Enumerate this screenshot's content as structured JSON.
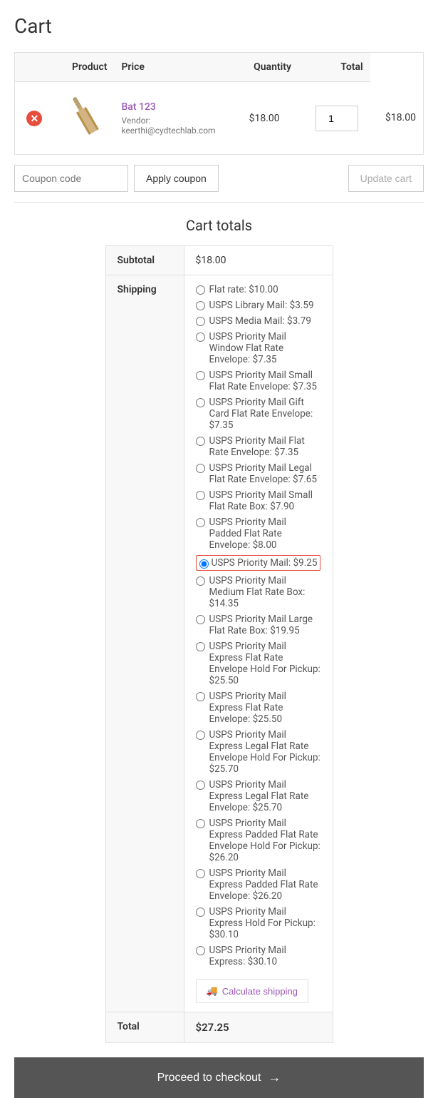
{
  "page": {
    "title": "Cart"
  },
  "table": {
    "headers": {
      "product": "Product",
      "price": "Price",
      "quantity": "Quantity",
      "total": "Total"
    }
  },
  "cart_item": {
    "product_name": "Bat 123",
    "product_link": "#",
    "vendor_label": "Vendor:",
    "vendor_email": "keerthi@cydtechlab.com",
    "price": "$18.00",
    "quantity": 1,
    "total": "$18.00"
  },
  "coupon": {
    "placeholder": "Coupon code",
    "apply_label": "Apply coupon",
    "update_label": "Update cart"
  },
  "cart_totals": {
    "title": "Cart totals",
    "subtotal_label": "Subtotal",
    "subtotal_value": "$18.00",
    "shipping_label": "Shipping",
    "total_label": "Total",
    "total_value": "$27.25"
  },
  "shipping_options": [
    {
      "id": "flat_rate",
      "label": "Flat rate: $10.00",
      "selected": false
    },
    {
      "id": "usps_library",
      "label": "USPS Library Mail: $3.59",
      "selected": false
    },
    {
      "id": "usps_media",
      "label": "USPS Media Mail: $3.79",
      "selected": false
    },
    {
      "id": "usps_priority_window",
      "label": "USPS Priority Mail Window Flat Rate Envelope: $7.35",
      "selected": false
    },
    {
      "id": "usps_priority_small_env",
      "label": "USPS Priority Mail Small Flat Rate Envelope: $7.35",
      "selected": false
    },
    {
      "id": "usps_priority_gift",
      "label": "USPS Priority Mail Gift Card Flat Rate Envelope: $7.35",
      "selected": false
    },
    {
      "id": "usps_priority_flat",
      "label": "USPS Priority Mail Flat Rate Envelope: $7.35",
      "selected": false
    },
    {
      "id": "usps_priority_legal",
      "label": "USPS Priority Mail Legal Flat Rate Envelope: $7.65",
      "selected": false
    },
    {
      "id": "usps_priority_small_box",
      "label": "USPS Priority Mail Small Flat Rate Box: $7.90",
      "selected": false
    },
    {
      "id": "usps_priority_padded",
      "label": "USPS Priority Mail Padded Flat Rate Envelope: $8.00",
      "selected": false
    },
    {
      "id": "usps_priority",
      "label": "USPS Priority Mail: $9.25",
      "selected": true
    },
    {
      "id": "usps_priority_medium",
      "label": "USPS Priority Mail Medium Flat Rate Box: $14.35",
      "selected": false
    },
    {
      "id": "usps_priority_large",
      "label": "USPS Priority Mail Large Flat Rate Box: $19.95",
      "selected": false
    },
    {
      "id": "usps_express_env_pickup",
      "label": "USPS Priority Mail Express Flat Rate Envelope Hold For Pickup: $25.50",
      "selected": false
    },
    {
      "id": "usps_express_env",
      "label": "USPS Priority Mail Express Flat Rate Envelope: $25.50",
      "selected": false
    },
    {
      "id": "usps_express_legal_pickup",
      "label": "USPS Priority Mail Express Legal Flat Rate Envelope Hold For Pickup: $25.70",
      "selected": false
    },
    {
      "id": "usps_express_legal",
      "label": "USPS Priority Mail Express Legal Flat Rate Envelope: $25.70",
      "selected": false
    },
    {
      "id": "usps_express_padded_pickup",
      "label": "USPS Priority Mail Express Padded Flat Rate Envelope Hold For Pickup: $26.20",
      "selected": false
    },
    {
      "id": "usps_express_padded",
      "label": "USPS Priority Mail Express Padded Flat Rate Envelope: $26.20",
      "selected": false
    },
    {
      "id": "usps_express_pickup",
      "label": "USPS Priority Mail Express Hold For Pickup: $30.10",
      "selected": false
    },
    {
      "id": "usps_express",
      "label": "USPS Priority Mail Express: $30.10",
      "selected": false
    }
  ],
  "calculate_shipping": {
    "label": "Calculate shipping",
    "icon": "🚚"
  },
  "checkout": {
    "label": "Proceed to checkout",
    "arrow": "→"
  }
}
